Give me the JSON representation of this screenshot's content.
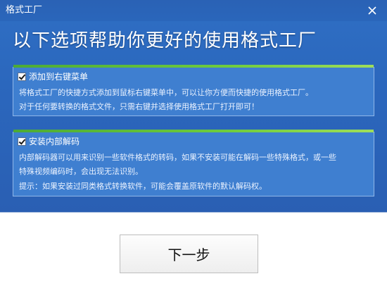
{
  "window": {
    "title": "格式工厂",
    "close_icon": "close-icon"
  },
  "header": {
    "headline": "以下选项帮助你更好的使用格式工厂"
  },
  "options": [
    {
      "checked": true,
      "title": "添加到右键菜单",
      "lines": [
        "将格式工厂的快捷方式添加到鼠标右键菜单中，可以让你方便而快捷的使用格式工厂。",
        "对于任何要转换的格式文件，只需右键并选择使用格式工厂打开即可！"
      ]
    },
    {
      "checked": true,
      "title": "安装内部解码",
      "lines": [
        "内部解码器可以用来识别一些软件格式的转码，如果不安装可能在解码一些特殊格式，或一些",
        "特殊视频编码时，会出现无法识别。",
        "提示：如果安装过同类格式转换软件，可能会覆盖原软件的默认解码权。"
      ]
    }
  ],
  "footer": {
    "next_label": "下一步"
  },
  "colors": {
    "title_bar": "#2a62b5",
    "panel": "#3f7fd0",
    "accent_green": "#6fcc3e"
  }
}
